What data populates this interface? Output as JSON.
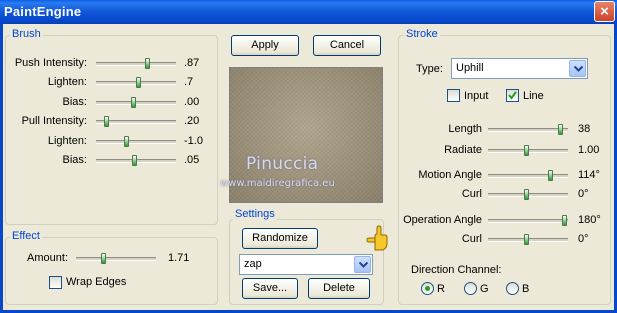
{
  "window": {
    "title": "PaintEngine",
    "close_label": "×"
  },
  "brush": {
    "label": "Brush",
    "rows": [
      {
        "label": "Push Intensity:",
        "value": ".87"
      },
      {
        "label": "Lighten:",
        "value": ".7"
      },
      {
        "label": "Bias:",
        "value": ".00"
      },
      {
        "label": "Pull Intensity:",
        "value": ".20"
      },
      {
        "label": "Lighten:",
        "value": "-1.0"
      },
      {
        "label": "Bias:",
        "value": ".05"
      }
    ]
  },
  "effect": {
    "label": "Effect",
    "amount_label": "Amount:",
    "amount_value": "1.71",
    "wrap_edges_label": "Wrap Edges",
    "wrap_edges_checked": false
  },
  "actions": {
    "apply_label": "Apply",
    "cancel_label": "Cancel"
  },
  "preview": {
    "watermark_name": "Pinuccia",
    "watermark_url": "www.maidiregrafica.eu"
  },
  "settings": {
    "label": "Settings",
    "randomize_label": "Randomize",
    "preset_value": "zap",
    "save_label": "Save...",
    "delete_label": "Delete"
  },
  "stroke": {
    "label": "Stroke",
    "type_label": "Type:",
    "type_value": "Uphill",
    "input_label": "Input",
    "input_checked": false,
    "line_label": "Line",
    "line_checked": true,
    "length_label": "Length",
    "length_value": "38",
    "radiate_label": "Radiate",
    "radiate_value": "1.00",
    "motion_angle_label": "Motion Angle",
    "motion_angle_value": "114°",
    "curl1_label": "Curl",
    "curl1_value": "0°",
    "operation_angle_label": "Operation Angle",
    "operation_angle_value": "180°",
    "curl2_label": "Curl",
    "curl2_value": "0°",
    "direction_label": "Direction Channel:",
    "channels": [
      "R",
      "G",
      "B"
    ],
    "selected_channel": "R"
  },
  "colors": {
    "accent": "#0046d5",
    "title_bar": "#0a5fe8",
    "close": "#c8442a",
    "thumb": "#2e9b2e"
  }
}
